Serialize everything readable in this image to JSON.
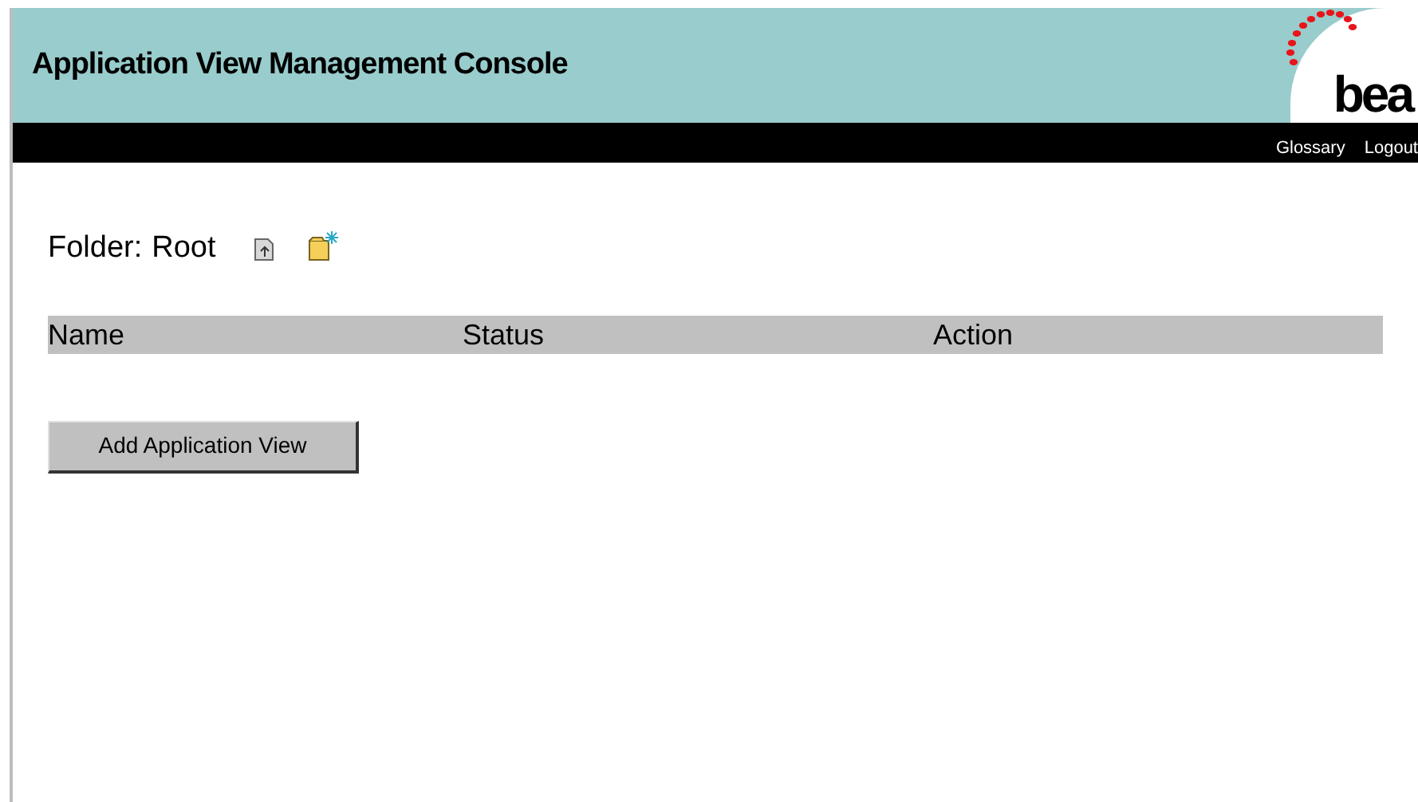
{
  "header": {
    "title": "Application View Management Console",
    "logo": "bea"
  },
  "nav": {
    "links": [
      "Glossary",
      "Logout"
    ]
  },
  "folder": {
    "label": "Folder:",
    "name": "Root"
  },
  "table": {
    "columns": [
      "Name",
      "Status",
      "Action"
    ]
  },
  "buttons": [
    "Add Application View"
  ]
}
